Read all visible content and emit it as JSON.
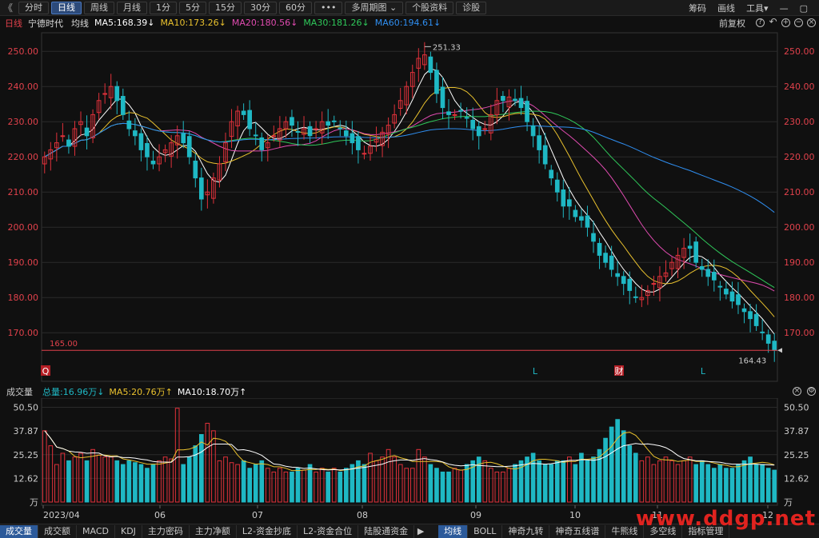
{
  "toolbar": {
    "back_glyph": "《",
    "tabs": [
      "分时",
      "日线",
      "周线",
      "月线",
      "1分",
      "5分",
      "15分",
      "30分",
      "60分",
      "•••",
      "多周期图 ⌄",
      "个股资料",
      "诊股"
    ],
    "active_tab": 1,
    "right_items": [
      "筹码",
      "画线",
      "工具▾"
    ],
    "window_controls": [
      "—",
      "▢"
    ]
  },
  "info": {
    "period": "日线",
    "stock_name": "宁德时代",
    "ma_line_label": "均线",
    "ma5": "MA5:168.39↓",
    "ma10": "MA10:173.26↓",
    "ma20": "MA20:180.56↓",
    "ma30": "MA30:181.26↓",
    "ma60": "MA60:194.61↓",
    "adjust": "前复权"
  },
  "colors": {
    "up": "#e0313a",
    "down": "#1fb8c4",
    "ma5": "#ffffff",
    "ma10": "#e9c12e",
    "ma20": "#e04bb0",
    "ma30": "#2fc85a",
    "ma60": "#2f8ef0",
    "grid": "#2a2a2a",
    "axis_text": "#e0414b"
  },
  "price_axis": {
    "labels": [
      "250.00",
      "240.00",
      "230.00",
      "220.00",
      "210.00",
      "200.00",
      "190.00",
      "180.00",
      "170.00"
    ],
    "high_label": "251.33",
    "low_label": "164.43",
    "line_label": "165.00"
  },
  "markers": [
    "Q",
    "L",
    "财",
    "L"
  ],
  "volume": {
    "title": "成交量",
    "total": "总量:16.96万↓",
    "ma5": "MA5:20.76万↑",
    "ma10": "MA10:18.70万↑",
    "axis_labels": [
      "50.50",
      "37.87",
      "25.25",
      "12.62",
      "万"
    ]
  },
  "x_axis_labels": [
    "2023/04",
    "06",
    "07",
    "08",
    "09",
    "10",
    "11",
    "12"
  ],
  "bottom_tabs_left": [
    "成交量",
    "成交额",
    "MACD",
    "KDJ",
    "主力密码",
    "主力净额",
    "L2-资金抄底",
    "L2-资金合位",
    "陆股通资金"
  ],
  "bottom_tabs_right": [
    "均线",
    "BOLL",
    "神奇九转",
    "神奇五线谱",
    "牛熊线",
    "多空线",
    "指标管理"
  ],
  "watermark": "www.ddgp.net",
  "chart_data": {
    "type": "candlestick",
    "title": "宁德时代 日线",
    "ylim": [
      163,
      253
    ],
    "closes": [
      220,
      222,
      224,
      226,
      223,
      228,
      230,
      226,
      232,
      236,
      238,
      240,
      236,
      232,
      228,
      226,
      222,
      220,
      218,
      220,
      222,
      224,
      226,
      224,
      220,
      214,
      208,
      210,
      214,
      218,
      224,
      230,
      233,
      232,
      228,
      226,
      222,
      224,
      226,
      228,
      230,
      229,
      227,
      228,
      226,
      228,
      230,
      229,
      230,
      228,
      226,
      224,
      222,
      221,
      223,
      225,
      227,
      229,
      232,
      236,
      240,
      244,
      248,
      249,
      244,
      238,
      234,
      232,
      232,
      233,
      231,
      228,
      226,
      228,
      232,
      236,
      236,
      237,
      236,
      234,
      230,
      226,
      222,
      218,
      214,
      210,
      206,
      206,
      203,
      202,
      200,
      196,
      192,
      190,
      188,
      186,
      184,
      182,
      180,
      180,
      182,
      184,
      186,
      187,
      190,
      192,
      194,
      194,
      190,
      188,
      186,
      185,
      183,
      181,
      179,
      178,
      176,
      174,
      172,
      170,
      167,
      165
    ],
    "volumes": [
      38,
      30,
      20,
      26,
      22,
      24,
      26,
      22,
      28,
      25,
      24,
      24,
      22,
      20,
      22,
      21,
      20,
      18,
      20,
      22,
      24,
      23,
      50,
      20,
      24,
      30,
      36,
      42,
      38,
      22,
      24,
      21,
      20,
      22,
      18,
      20,
      22,
      18,
      16,
      18,
      16,
      16,
      18,
      17,
      20,
      16,
      18,
      16,
      18,
      16,
      18,
      20,
      22,
      20,
      26,
      22,
      24,
      28,
      24,
      20,
      18,
      18,
      28,
      24,
      20,
      18,
      16,
      16,
      18,
      17,
      20,
      22,
      24,
      22,
      18,
      16,
      16,
      18,
      20,
      22,
      24,
      26,
      22,
      20,
      20,
      22,
      22,
      24,
      20,
      26,
      22,
      24,
      28,
      34,
      40,
      44,
      38,
      30,
      26,
      22,
      24,
      20,
      22,
      24,
      22,
      20,
      22,
      24,
      20,
      22,
      20,
      18,
      20,
      18,
      18,
      20,
      22,
      24,
      20,
      20,
      18,
      17
    ],
    "ma_current": {
      "MA5": 168.39,
      "MA10": 173.26,
      "MA20": 180.56,
      "MA30": 181.26,
      "MA60": 194.61
    }
  }
}
